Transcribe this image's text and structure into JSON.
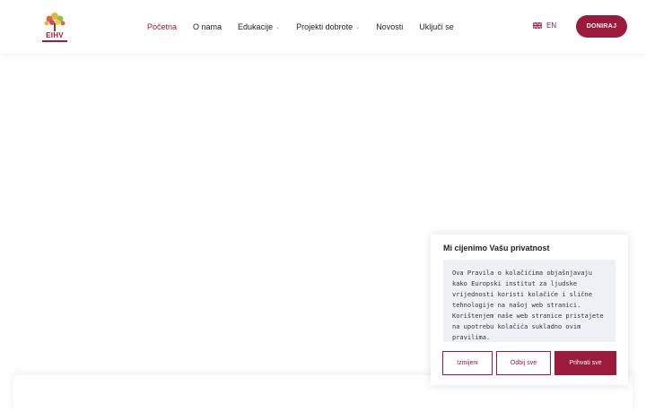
{
  "brand": {
    "logo_text": "EIHV",
    "accent": "#9c1a3b"
  },
  "nav": {
    "items": [
      {
        "label": "Početna",
        "active": true,
        "dropdown": false
      },
      {
        "label": "O nama",
        "active": false,
        "dropdown": false
      },
      {
        "label": "Edukacije",
        "active": false,
        "dropdown": true
      },
      {
        "label": "Projekti dobrote",
        "active": false,
        "dropdown": true
      },
      {
        "label": "Novosti",
        "active": false,
        "dropdown": false
      },
      {
        "label": "Uključi se",
        "active": false,
        "dropdown": false
      }
    ]
  },
  "lang": {
    "label": "EN",
    "icon": "uk-flag-icon"
  },
  "donate": {
    "label": "DONIRAJ"
  },
  "cookie": {
    "title": "Mi cijenimo Vašu privatnost",
    "text": "Ova Pravila o kolačićima objašnjavaju kako Europski institut za ljudske vrijednosti koristi kolačiće i slične tehnologije na našoj web stranici. Korištenjem naše web stranice pristajete na upotrebu kolačića sukladno ovim pravilima.",
    "buttons": {
      "customize": "Izmijeni",
      "reject": "Odbij sve",
      "accept": "Prihvati sve"
    }
  }
}
